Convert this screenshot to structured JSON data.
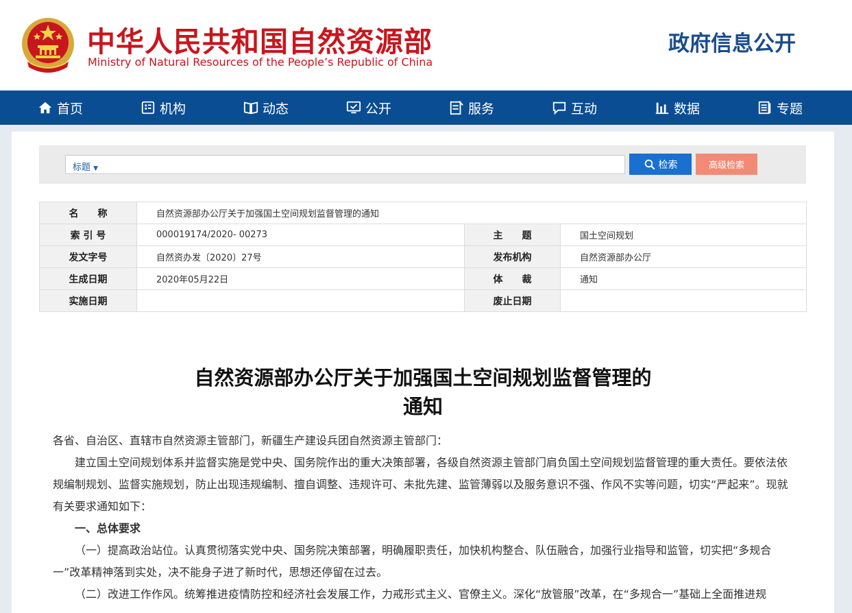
{
  "header": {
    "title_cn": "中华人民共和国自然资源部",
    "title_en": "Ministry of Natural Resources of the People’s Republic of China",
    "section_title": "政府信息公开"
  },
  "nav": {
    "items": [
      {
        "label": "首页",
        "icon": "home-icon"
      },
      {
        "label": "机构",
        "icon": "organization-icon"
      },
      {
        "label": "动态",
        "icon": "news-book-icon"
      },
      {
        "label": "公开",
        "icon": "monitor-icon"
      },
      {
        "label": "服务",
        "icon": "service-form-icon"
      },
      {
        "label": "互动",
        "icon": "chat-icon"
      },
      {
        "label": "数据",
        "icon": "bar-chart-icon"
      },
      {
        "label": "专题",
        "icon": "topic-icon"
      }
    ]
  },
  "search": {
    "type_label": "标题",
    "type_arrow": "▼",
    "value": "",
    "search_button": "检索",
    "advanced_button": "高级检索"
  },
  "meta": {
    "name_label": "名　　称",
    "name_value": "自然资源部办公厅关于加强国土空间规划监督管理的通知",
    "index_label": "索 引 号",
    "index_value": "000019174/2020- 00273",
    "subject_label": "主　　题",
    "subject_value": "国土空间规划",
    "doc_no_label": "发文字号",
    "doc_no_value": "自然资办发〔2020〕27号",
    "publisher_label": "发布机构",
    "publisher_value": "自然资源部办公厅",
    "created_label": "生成日期",
    "created_value": "2020年05月22日",
    "genre_label": "体　　裁",
    "genre_value": "通知",
    "effective_label": "实施日期",
    "effective_value": "",
    "abolish_label": "废止日期",
    "abolish_value": ""
  },
  "article": {
    "title_line1": "自然资源部办公厅关于加强国土空间规划监督管理的",
    "title_line2": "通知",
    "salutation": "各省、自治区、直辖市自然资源主管部门，新疆生产建设兵团自然资源主管部门：",
    "para1": "建立国土空间规划体系并监督实施是党中央、国务院作出的重大决策部署，各级自然资源主管部门肩负国土空间规划监督管理的重大责任。要依法依规编制规划、监督实施规划，防止出现违规编制、擅自调整、违规许可、未批先建、监管薄弱以及服务意识不强、作风不实等问题，切实“严起来”。现就有关要求通知如下：",
    "heading1": "一、总体要求",
    "item1": "（一）提高政治站位。认真贯彻落实党中央、国务院决策部署，明确履职责任，加快机构整合、队伍融合，加强行业指导和监管，切实把“多规合一”改革精神落到实处，决不能身子进了新时代，思想还停留在过去。",
    "item2": "（二）改进工作作风。统筹推进疫情防控和经济社会发展工作，力戒形式主义、官僚主义。深化“放管服”改革，在“多规合一”基础上全面推进规"
  }
}
